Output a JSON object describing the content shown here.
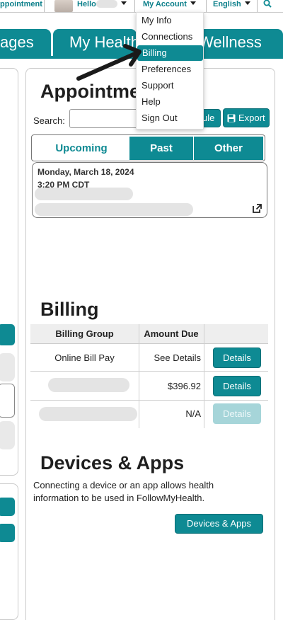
{
  "topbar": {
    "left_link": "ppointment",
    "greeting": "Hello",
    "my_account": "My Account",
    "language": "English"
  },
  "nav": {
    "tabs": [
      "ages",
      "My Health",
      "Wellness"
    ]
  },
  "dropdown": {
    "items": [
      "My Info",
      "Connections",
      "Billing",
      "Preferences",
      "Support",
      "Help",
      "Sign Out"
    ]
  },
  "appointments": {
    "title": "Appointments",
    "search_label": "Search:",
    "search_value": "",
    "schedule_label": "ule",
    "export_label": "Export",
    "tabs": [
      "Upcoming",
      "Past",
      "Other"
    ],
    "card": {
      "date": "Monday, March 18, 2024",
      "time": "3:20 PM CDT"
    }
  },
  "billing": {
    "title": "Billing",
    "columns": [
      "Billing Group",
      "Amount Due"
    ],
    "rows": [
      {
        "group": "Online Bill Pay",
        "amount": "See Details",
        "action": "Details",
        "enabled": true
      },
      {
        "group": "",
        "amount": "$396.92",
        "action": "Details",
        "enabled": true
      },
      {
        "group": "",
        "amount": "N/A",
        "action": "Details",
        "enabled": false
      }
    ]
  },
  "devices": {
    "title": "Devices & Apps",
    "description": "Connecting a device or an app allows health information to be used in FollowMyHealth.",
    "button": "Devices & Apps"
  },
  "colors": {
    "accent": "#0e8a93",
    "accent_disabled": "#a6d5d9"
  }
}
